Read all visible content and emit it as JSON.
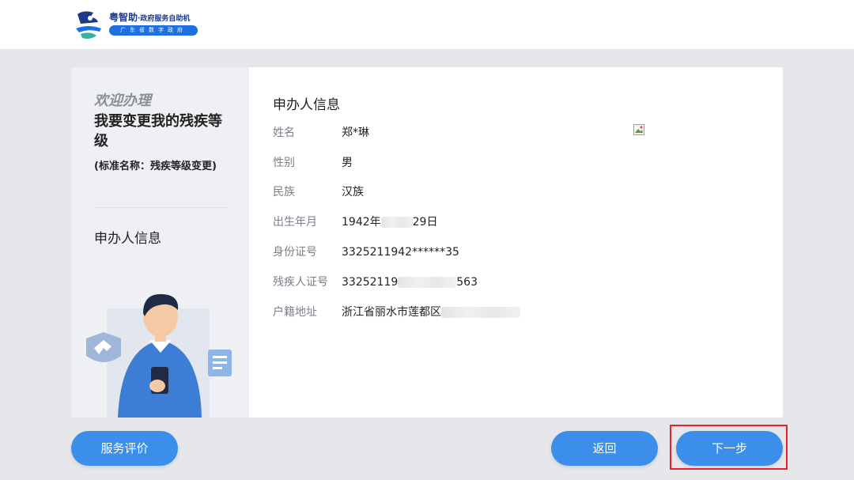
{
  "header": {
    "logo_main": "粤智助",
    "logo_sub": "·政府服务自助机",
    "logo_pill": "广东省数字政府"
  },
  "sidebar": {
    "welcome": "欢迎办理",
    "service_name": "我要变更我的残疾等级",
    "standard_name": "(标准名称：残疾等级变更)",
    "current_step": "申办人信息"
  },
  "applicant": {
    "section_title": "申办人信息",
    "fields": [
      {
        "label": "姓名",
        "value": "郑*琳"
      },
      {
        "label": "性别",
        "value": "男"
      },
      {
        "label": "民族",
        "value": "汉族"
      },
      {
        "label": "出生年月",
        "value_prefix": "1942年",
        "value_suffix": "29日"
      },
      {
        "label": "身份证号",
        "value": "3325211942******35"
      },
      {
        "label": "残疾人证号",
        "value_prefix": "33252119",
        "value_suffix": "563"
      },
      {
        "label": "户籍地址",
        "value_prefix": "浙江省丽水市莲都区",
        "value_suffix": ""
      }
    ]
  },
  "buttons": {
    "rate": "服务评价",
    "back": "返回",
    "next": "下一步"
  },
  "colors": {
    "primary_button": "#3b8eea",
    "highlight": "#e8202a",
    "logo_blue": "#1e6fe0"
  }
}
